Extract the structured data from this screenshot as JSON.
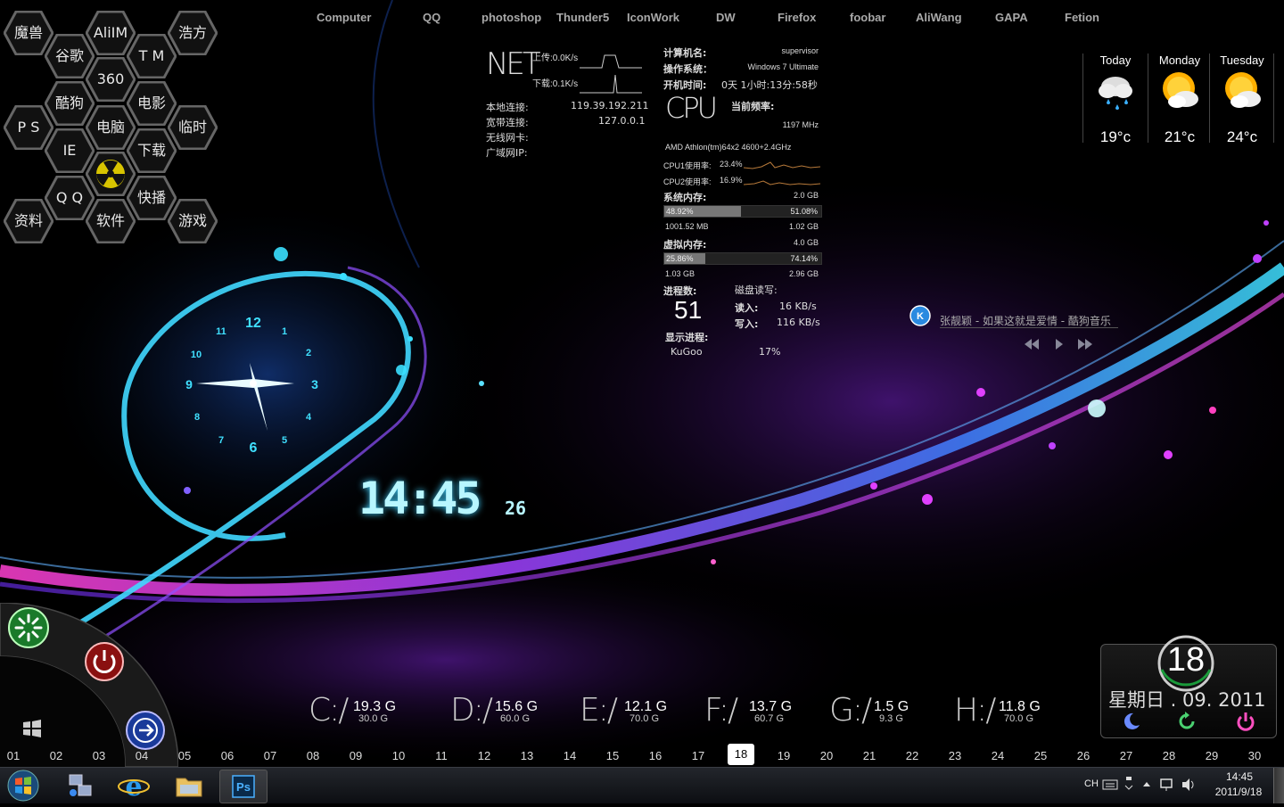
{
  "top_shortcuts": [
    "Computer",
    "QQ",
    "photoshop",
    "Thunder5",
    "IconWork",
    "DW",
    "Firefox",
    "foobar",
    "AliWang",
    "GAPA",
    "Fetion"
  ],
  "hex_launcher": [
    "魔兽",
    "AliIM",
    "浩方",
    "谷歌",
    "T M",
    "360",
    "酷狗",
    "电影",
    "P S",
    "电脑",
    "临时",
    "IE",
    "下载",
    "Q Q",
    "快播",
    "资料",
    "软件",
    "游戏"
  ],
  "net": {
    "title": "NET",
    "upload": "上传:0.0K/s",
    "download": "下载:0.1K/s",
    "rows": [
      {
        "label": "本地连接:",
        "value": "119.39.192.211"
      },
      {
        "label": "宽带连接:",
        "value": "127.0.0.1"
      },
      {
        "label": "无线网卡:",
        "value": ""
      },
      {
        "label": "广域网IP:",
        "value": ""
      }
    ]
  },
  "sys": {
    "computer_name_label": "计算机名:",
    "computer_name": "supervisor",
    "os_label": "操作系统：",
    "os": "Windows 7 Ultimate",
    "uptime_label": "开机时间:",
    "uptime": "0天 1小时:13分:58秒",
    "cpu_title": "CPU",
    "freq_label": "当前频率:",
    "freq": "1197 MHz",
    "cpu_model": "AMD Athlon(tm)64x2 4600+2.4GHz",
    "cpu1_label": "CPU1使用率:",
    "cpu1": "23.4%",
    "cpu2_label": "CPU2使用率:",
    "cpu2": "16.9%",
    "mem_label": "系统内存:",
    "mem_total": "2.0 GB",
    "mem_used_pct": "48.92%",
    "mem_free_pct": "51.08%",
    "mem_used_fraction": 0.4892,
    "mem_used": "1001.52 MB",
    "mem_free": "1.02 GB",
    "vmem_label": "虚拟内存:",
    "vmem_total": "4.0 GB",
    "vmem_used_pct": "25.86%",
    "vmem_free_pct": "74.14%",
    "vmem_used_fraction": 0.2586,
    "vmem_used": "1.03 GB",
    "vmem_free": "2.96 GB",
    "proc_label": "进程数:",
    "proc_count": "51",
    "disk_label": "磁盘读写:",
    "read_label": "读入:",
    "read": "16 KB/s",
    "write_label": "写入:",
    "write": "116 KB/s",
    "show_proc_label": "显示进程:",
    "show_proc": "KuGoo",
    "show_proc_pct": "17%"
  },
  "weather": [
    {
      "day": "Today",
      "temp": "19°c",
      "icon": "rain-cloud-icon"
    },
    {
      "day": "Monday",
      "temp": "21°c",
      "icon": "sun-cloud-icon"
    },
    {
      "day": "Tuesday",
      "temp": "24°c",
      "icon": "sun-cloud-icon"
    }
  ],
  "music": {
    "track": "张靓颖 - 如果这就是爱情 - 酷狗音乐"
  },
  "clock": {
    "digital": "14:45",
    "seconds": "26",
    "dial_numbers": [
      "12",
      "1",
      "2",
      "3",
      "4",
      "5",
      "6",
      "7",
      "8",
      "9",
      "10",
      "11"
    ]
  },
  "drives": [
    {
      "letter": "C:/",
      "free": "19.3 G",
      "total": "30.0 G"
    },
    {
      "letter": "D:/",
      "free": "15.6 G",
      "total": "60.0 G"
    },
    {
      "letter": "E:/",
      "free": "12.1 G",
      "total": "70.0 G"
    },
    {
      "letter": "F:/",
      "free": "13.7 G",
      "total": "60.7 G"
    },
    {
      "letter": "G:/",
      "free": "1.5 G",
      "total": "9.3 G"
    },
    {
      "letter": "H:/",
      "free": "11.8 G",
      "total": "70.0 G"
    }
  ],
  "calendar_days": [
    "01",
    "02",
    "03",
    "04",
    "05",
    "06",
    "07",
    "08",
    "09",
    "10",
    "11",
    "12",
    "13",
    "14",
    "15",
    "16",
    "17",
    "18",
    "19",
    "20",
    "21",
    "22",
    "23",
    "24",
    "25",
    "26",
    "27",
    "28",
    "29",
    "30"
  ],
  "today_day": "18",
  "date_widget": {
    "day": "18",
    "line": "星期日 . 09. 2011"
  },
  "taskbar": {
    "lang": "CH",
    "time": "14:45",
    "date": "2011/9/18"
  },
  "colors": {
    "accent_cyan": "#29d3ff",
    "accent_purple": "#c040ff",
    "accent_pink": "#ff40c0"
  }
}
